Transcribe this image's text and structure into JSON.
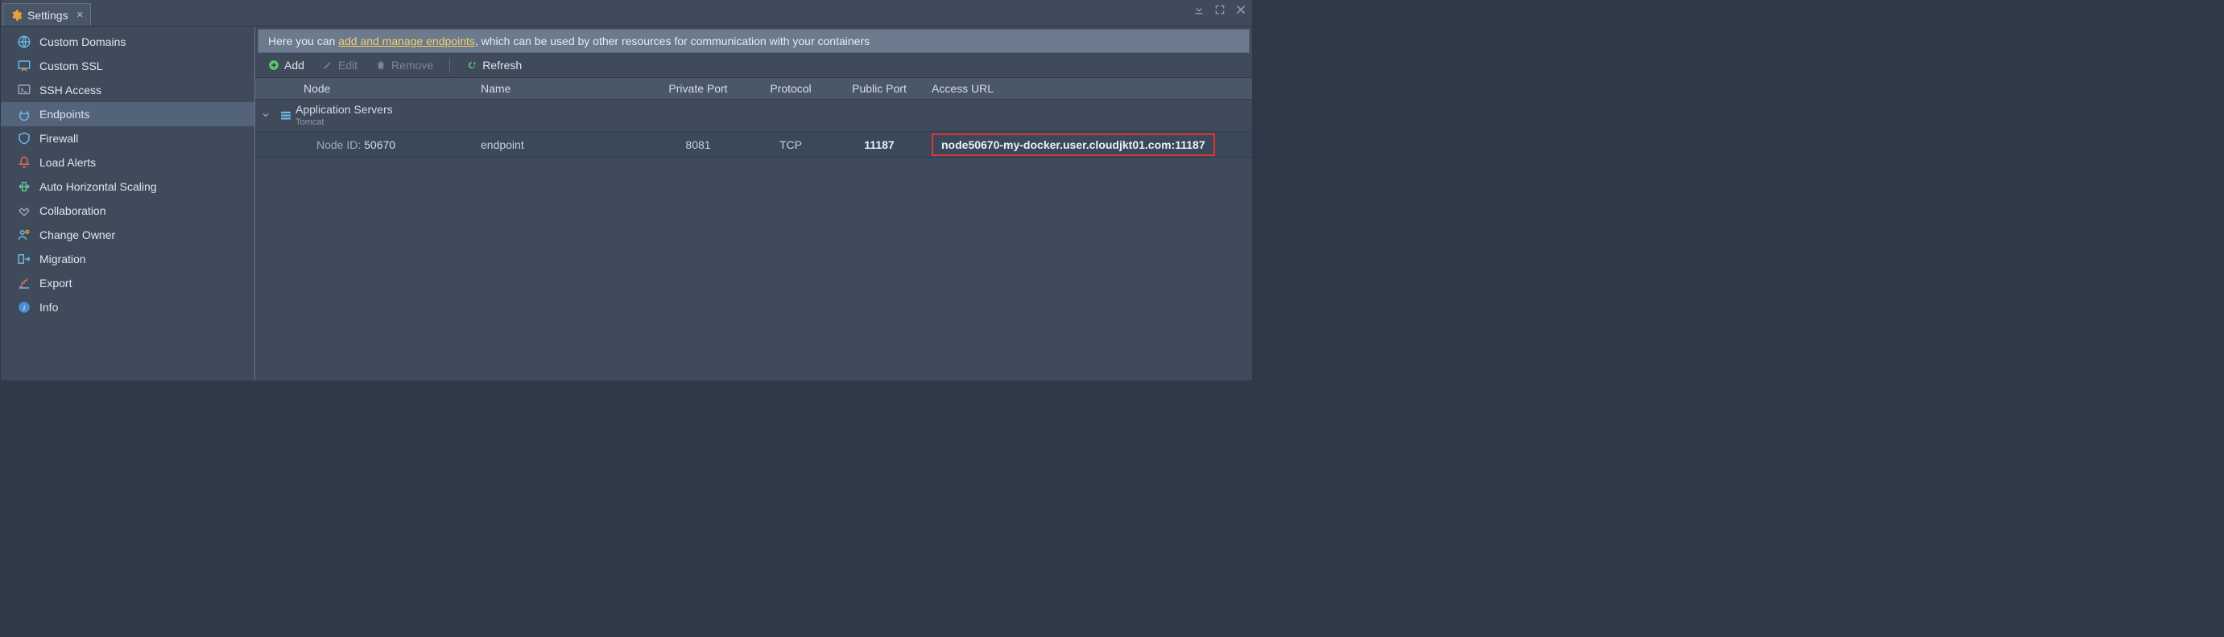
{
  "tab": {
    "title": "Settings"
  },
  "sidebar": {
    "items": [
      {
        "label": "Custom Domains"
      },
      {
        "label": "Custom SSL"
      },
      {
        "label": "SSH Access"
      },
      {
        "label": "Endpoints"
      },
      {
        "label": "Firewall"
      },
      {
        "label": "Load Alerts"
      },
      {
        "label": "Auto Horizontal Scaling"
      },
      {
        "label": "Collaboration"
      },
      {
        "label": "Change Owner"
      },
      {
        "label": "Migration"
      },
      {
        "label": "Export"
      },
      {
        "label": "Info"
      }
    ]
  },
  "info": {
    "pre": "Here you can ",
    "link": "add and manage endpoints",
    "post": ", which can be used by other resources for communication with your containers"
  },
  "toolbar": {
    "add": "Add",
    "edit": "Edit",
    "remove": "Remove",
    "refresh": "Refresh"
  },
  "columns": {
    "node": "Node",
    "name": "Name",
    "pport": "Private Port",
    "proto": "Protocol",
    "pub": "Public Port",
    "url": "Access URL"
  },
  "group": {
    "title": "Application Servers",
    "sub": "Tomcat"
  },
  "row": {
    "node_label": "Node ID: ",
    "node_id": "50670",
    "name": "endpoint",
    "pport": "8081",
    "proto": "TCP",
    "pub": "11187",
    "url": "node50670-my-docker.user.cloudjkt01.com:11187"
  }
}
